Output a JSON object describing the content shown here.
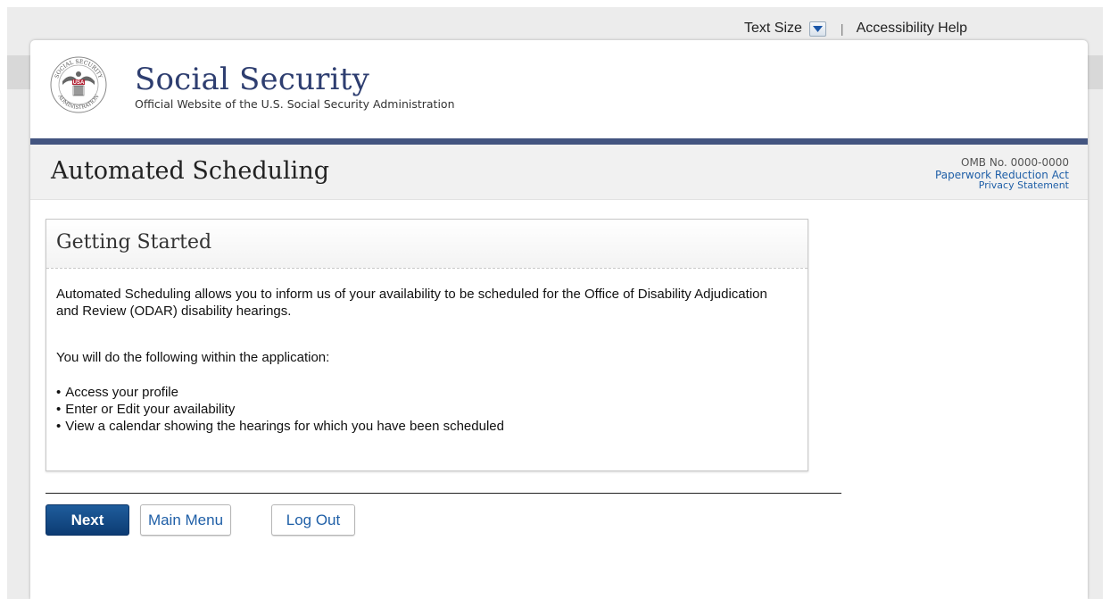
{
  "utility": {
    "text_size_label": "Text Size",
    "separator": "|",
    "accessibility_help": "Accessibility Help"
  },
  "header": {
    "seal_top_text": "SOCIAL SECURITY",
    "seal_bottom_text": "ADMINISTRATION",
    "seal_badge": "USA",
    "brand_title": "Social Security",
    "brand_subtitle": "Official Website of the U.S. Social Security Administration"
  },
  "title_bar": {
    "page_title": "Automated Scheduling",
    "omb_number": "OMB No. 0000-0000",
    "paperwork_link": "Paperwork Reduction Act",
    "privacy_link": "Privacy Statement"
  },
  "card": {
    "title": "Getting Started",
    "intro": "Automated Scheduling allows you to inform us of your availability to be scheduled for the Office of Disability Adjudication and Review (ODAR) disability hearings.",
    "lead": "You will do the following within the application:",
    "items": [
      "Access your profile",
      "Enter or Edit your availability",
      "View a calendar showing the hearings for which you have been scheduled"
    ]
  },
  "buttons": {
    "next": "Next",
    "main_menu": "Main Menu",
    "log_out": "Log Out"
  },
  "colors": {
    "brand_navy": "#2e3e70",
    "rule_blue": "#435580",
    "link_blue": "#1f5fa7",
    "primary_button": "#0c3b73"
  }
}
